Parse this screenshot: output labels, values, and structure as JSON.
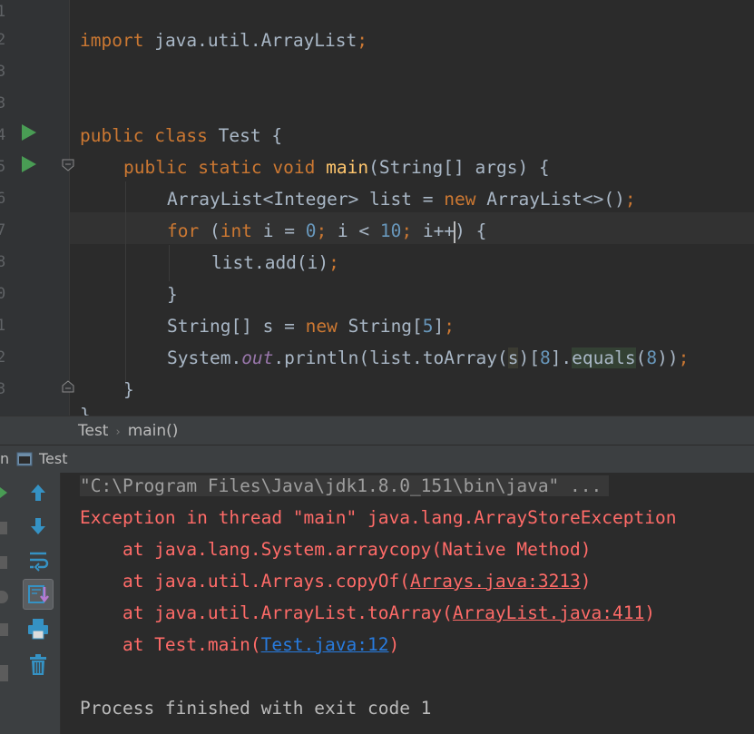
{
  "editor": {
    "line_numbers": [
      "1",
      "2",
      "3",
      "4",
      "5",
      "6",
      "7",
      "8",
      "9",
      "0",
      "1",
      "2",
      "3"
    ],
    "code": {
      "l2": {
        "kw": "import",
        "rest": "java.util.ArrayList",
        "semi": ";"
      },
      "l5": {
        "kw1": "public",
        "kw2": "class",
        "name": "Test",
        "brace": "{"
      },
      "l6": {
        "kw1": "public",
        "kw2": "static",
        "kw3": "void",
        "fn": "main",
        "params": "(String[] args) {"
      },
      "l7": {
        "a": "ArrayList<Integer> list = ",
        "kw": "new",
        "b": "ArrayList<>()",
        "semi": ";"
      },
      "l8": {
        "kw": "for",
        "a": "(",
        "kw2": "int",
        "b": "i = ",
        "n0": "0",
        "s1": "; ",
        "c": "i < ",
        "n10": "10",
        "s2": ";",
        "d": " i++",
        "e": ") {"
      },
      "l9": {
        "a": "list.add(i)",
        "semi": ";"
      },
      "l10": {
        "a": "}"
      },
      "l11": {
        "a": "String[] s = ",
        "kw": "new",
        "b": "String[",
        "n": "5",
        "c": "]",
        "semi": ";"
      },
      "l12": {
        "a": "System.",
        "field": "out",
        "b": ".println(list.toArray(",
        "s": "s",
        "c": ")[",
        "n8": "8",
        "d": "].",
        "eq": "equals",
        "e": "(",
        "n8b": "8",
        "f": "))",
        "semi": ";"
      },
      "l13": {
        "a": "}"
      },
      "l14": {
        "a": "}"
      }
    }
  },
  "breadcrumb": {
    "class": "Test",
    "method": "main()",
    "sep": "›"
  },
  "run": {
    "tab_prefix": "n",
    "tab_label": "Test",
    "console": {
      "cmd": "\"C:\\Program Files\\Java\\jdk1.8.0_151\\bin\\java\" ...",
      "exception": "Exception in thread \"main\" java.lang.ArrayStoreException",
      "st1_a": "    at java.lang.System.arraycopy(Native Method)",
      "st2_a": "    at java.util.Arrays.copyOf(",
      "st2_link": "Arrays.java:3213",
      "st2_b": ")",
      "st3_a": "    at java.util.ArrayList.toArray(",
      "st3_link": "ArrayList.java:411",
      "st3_b": ")",
      "st4_a": "    at Test.main(",
      "st4_link": "Test.java:12",
      "st4_b": ")",
      "exit": "Process finished with exit code 1"
    }
  },
  "colors": {
    "keyword": "#cc7832",
    "number": "#6897bb",
    "function": "#ffc66d",
    "error": "#ff6b68",
    "link": "#287bde",
    "run_icon": "#499c54"
  }
}
